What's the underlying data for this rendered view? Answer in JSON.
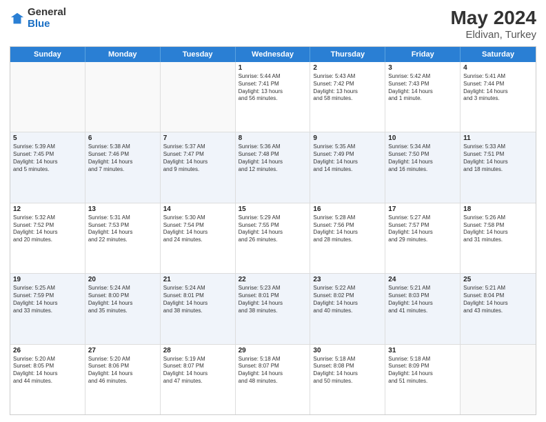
{
  "header": {
    "logo_general": "General",
    "logo_blue": "Blue",
    "title": "May 2024",
    "subtitle": "Eldivan, Turkey"
  },
  "weekdays": [
    "Sunday",
    "Monday",
    "Tuesday",
    "Wednesday",
    "Thursday",
    "Friday",
    "Saturday"
  ],
  "rows": [
    [
      {
        "day": "",
        "lines": [],
        "empty": true
      },
      {
        "day": "",
        "lines": [],
        "empty": true
      },
      {
        "day": "",
        "lines": [],
        "empty": true
      },
      {
        "day": "1",
        "lines": [
          "Sunrise: 5:44 AM",
          "Sunset: 7:41 PM",
          "Daylight: 13 hours",
          "and 56 minutes."
        ],
        "empty": false
      },
      {
        "day": "2",
        "lines": [
          "Sunrise: 5:43 AM",
          "Sunset: 7:42 PM",
          "Daylight: 13 hours",
          "and 58 minutes."
        ],
        "empty": false
      },
      {
        "day": "3",
        "lines": [
          "Sunrise: 5:42 AM",
          "Sunset: 7:43 PM",
          "Daylight: 14 hours",
          "and 1 minute."
        ],
        "empty": false
      },
      {
        "day": "4",
        "lines": [
          "Sunrise: 5:41 AM",
          "Sunset: 7:44 PM",
          "Daylight: 14 hours",
          "and 3 minutes."
        ],
        "empty": false
      }
    ],
    [
      {
        "day": "5",
        "lines": [
          "Sunrise: 5:39 AM",
          "Sunset: 7:45 PM",
          "Daylight: 14 hours",
          "and 5 minutes."
        ],
        "empty": false
      },
      {
        "day": "6",
        "lines": [
          "Sunrise: 5:38 AM",
          "Sunset: 7:46 PM",
          "Daylight: 14 hours",
          "and 7 minutes."
        ],
        "empty": false
      },
      {
        "day": "7",
        "lines": [
          "Sunrise: 5:37 AM",
          "Sunset: 7:47 PM",
          "Daylight: 14 hours",
          "and 9 minutes."
        ],
        "empty": false
      },
      {
        "day": "8",
        "lines": [
          "Sunrise: 5:36 AM",
          "Sunset: 7:48 PM",
          "Daylight: 14 hours",
          "and 12 minutes."
        ],
        "empty": false
      },
      {
        "day": "9",
        "lines": [
          "Sunrise: 5:35 AM",
          "Sunset: 7:49 PM",
          "Daylight: 14 hours",
          "and 14 minutes."
        ],
        "empty": false
      },
      {
        "day": "10",
        "lines": [
          "Sunrise: 5:34 AM",
          "Sunset: 7:50 PM",
          "Daylight: 14 hours",
          "and 16 minutes."
        ],
        "empty": false
      },
      {
        "day": "11",
        "lines": [
          "Sunrise: 5:33 AM",
          "Sunset: 7:51 PM",
          "Daylight: 14 hours",
          "and 18 minutes."
        ],
        "empty": false
      }
    ],
    [
      {
        "day": "12",
        "lines": [
          "Sunrise: 5:32 AM",
          "Sunset: 7:52 PM",
          "Daylight: 14 hours",
          "and 20 minutes."
        ],
        "empty": false
      },
      {
        "day": "13",
        "lines": [
          "Sunrise: 5:31 AM",
          "Sunset: 7:53 PM",
          "Daylight: 14 hours",
          "and 22 minutes."
        ],
        "empty": false
      },
      {
        "day": "14",
        "lines": [
          "Sunrise: 5:30 AM",
          "Sunset: 7:54 PM",
          "Daylight: 14 hours",
          "and 24 minutes."
        ],
        "empty": false
      },
      {
        "day": "15",
        "lines": [
          "Sunrise: 5:29 AM",
          "Sunset: 7:55 PM",
          "Daylight: 14 hours",
          "and 26 minutes."
        ],
        "empty": false
      },
      {
        "day": "16",
        "lines": [
          "Sunrise: 5:28 AM",
          "Sunset: 7:56 PM",
          "Daylight: 14 hours",
          "and 28 minutes."
        ],
        "empty": false
      },
      {
        "day": "17",
        "lines": [
          "Sunrise: 5:27 AM",
          "Sunset: 7:57 PM",
          "Daylight: 14 hours",
          "and 29 minutes."
        ],
        "empty": false
      },
      {
        "day": "18",
        "lines": [
          "Sunrise: 5:26 AM",
          "Sunset: 7:58 PM",
          "Daylight: 14 hours",
          "and 31 minutes."
        ],
        "empty": false
      }
    ],
    [
      {
        "day": "19",
        "lines": [
          "Sunrise: 5:25 AM",
          "Sunset: 7:59 PM",
          "Daylight: 14 hours",
          "and 33 minutes."
        ],
        "empty": false
      },
      {
        "day": "20",
        "lines": [
          "Sunrise: 5:24 AM",
          "Sunset: 8:00 PM",
          "Daylight: 14 hours",
          "and 35 minutes."
        ],
        "empty": false
      },
      {
        "day": "21",
        "lines": [
          "Sunrise: 5:24 AM",
          "Sunset: 8:01 PM",
          "Daylight: 14 hours",
          "and 38 minutes."
        ],
        "empty": false
      },
      {
        "day": "22",
        "lines": [
          "Sunrise: 5:23 AM",
          "Sunset: 8:01 PM",
          "Daylight: 14 hours",
          "and 38 minutes."
        ],
        "empty": false
      },
      {
        "day": "23",
        "lines": [
          "Sunrise: 5:22 AM",
          "Sunset: 8:02 PM",
          "Daylight: 14 hours",
          "and 40 minutes."
        ],
        "empty": false
      },
      {
        "day": "24",
        "lines": [
          "Sunrise: 5:21 AM",
          "Sunset: 8:03 PM",
          "Daylight: 14 hours",
          "and 41 minutes."
        ],
        "empty": false
      },
      {
        "day": "25",
        "lines": [
          "Sunrise: 5:21 AM",
          "Sunset: 8:04 PM",
          "Daylight: 14 hours",
          "and 43 minutes."
        ],
        "empty": false
      }
    ],
    [
      {
        "day": "26",
        "lines": [
          "Sunrise: 5:20 AM",
          "Sunset: 8:05 PM",
          "Daylight: 14 hours",
          "and 44 minutes."
        ],
        "empty": false
      },
      {
        "day": "27",
        "lines": [
          "Sunrise: 5:20 AM",
          "Sunset: 8:06 PM",
          "Daylight: 14 hours",
          "and 46 minutes."
        ],
        "empty": false
      },
      {
        "day": "28",
        "lines": [
          "Sunrise: 5:19 AM",
          "Sunset: 8:07 PM",
          "Daylight: 14 hours",
          "and 47 minutes."
        ],
        "empty": false
      },
      {
        "day": "29",
        "lines": [
          "Sunrise: 5:18 AM",
          "Sunset: 8:07 PM",
          "Daylight: 14 hours",
          "and 48 minutes."
        ],
        "empty": false
      },
      {
        "day": "30",
        "lines": [
          "Sunrise: 5:18 AM",
          "Sunset: 8:08 PM",
          "Daylight: 14 hours",
          "and 50 minutes."
        ],
        "empty": false
      },
      {
        "day": "31",
        "lines": [
          "Sunrise: 5:18 AM",
          "Sunset: 8:09 PM",
          "Daylight: 14 hours",
          "and 51 minutes."
        ],
        "empty": false
      },
      {
        "day": "",
        "lines": [],
        "empty": true
      }
    ]
  ]
}
